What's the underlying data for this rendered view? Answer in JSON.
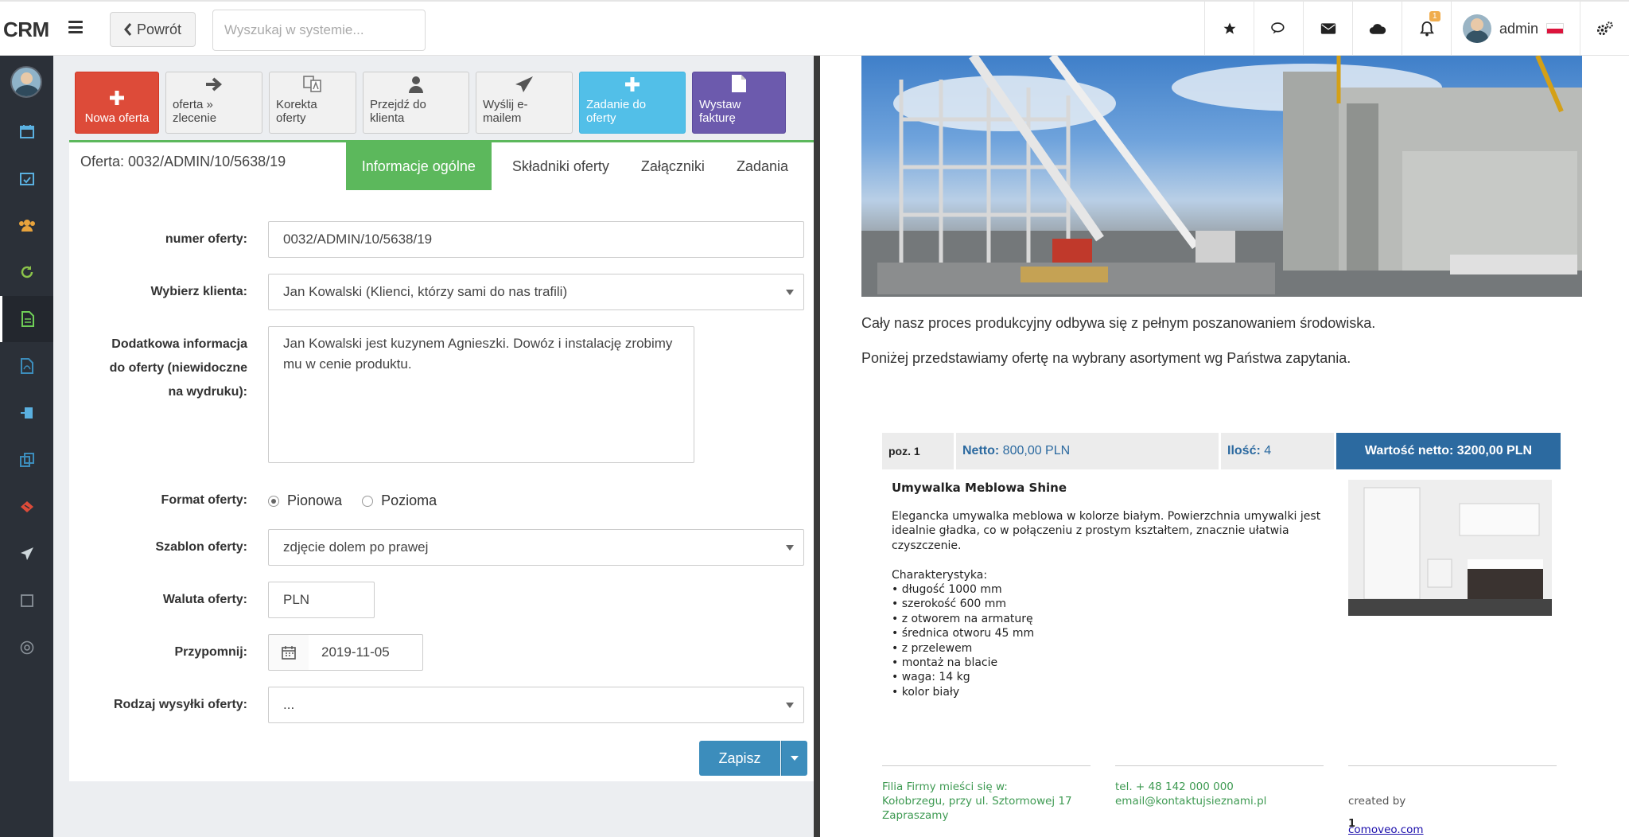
{
  "app": {
    "logo": "CRM"
  },
  "topbar": {
    "back_label": "Powrót",
    "search_placeholder": "Wyszukaj w systemie...",
    "notification_count": "1",
    "user_name": "admin"
  },
  "toolbar": {
    "new_offer": "Nowa oferta",
    "offer_to_order": "oferta » zlecenie",
    "correction": "Korekta oferty",
    "go_to_client": "Przejdź do klienta",
    "send_email": "Wyślij e-mailem",
    "task": "Zadanie do oferty",
    "invoice": "Wystaw fakturę"
  },
  "offer": {
    "title": "Oferta: 0032/ADMIN/10/5638/19",
    "tabs": [
      "Informacje ogólne",
      "Składniki oferty",
      "Załączniki",
      "Zadania"
    ]
  },
  "form": {
    "number_label": "numer oferty:",
    "number_value": "0032/ADMIN/10/5638/19",
    "client_label": "Wybierz klienta:",
    "client_value": "Jan Kowalski (Klienci, którzy sami do nas trafili)",
    "info_label_1": "Dodatkowa informacja",
    "info_label_2": "do oferty (niewidoczne",
    "info_label_3": "na wydruku):",
    "info_value": "Jan Kowalski jest kuzynem Agnieszki. Dowóz i instalację zrobimy mu w cenie produktu.",
    "format_label": "Format oferty:",
    "format_opt1": "Pionowa",
    "format_opt2": "Pozioma",
    "template_label": "Szablon oferty:",
    "template_value": "zdjęcie dolem po prawej",
    "currency_label": "Waluta oferty:",
    "currency_value": "PLN",
    "reminder_label": "Przypomnij:",
    "reminder_value": "2019-11-05",
    "shipping_label": "Rodzaj wysyłki oferty:",
    "shipping_value": "...",
    "save_label": "Zapisz"
  },
  "preview": {
    "para1": "Cały nasz proces produkcyjny odbywa się z pełnym poszanowaniem środowiska.",
    "para2": "Poniżej przedstawiamy ofertę na wybrany asortyment wg Państwa zapytania.",
    "pos_label": "poz. 1",
    "netto_label": "Netto:",
    "netto_value": "800,00 PLN",
    "qty_label": "Ilość:",
    "qty_value": "4",
    "total_label": "Wartość netto: 3200,00 PLN",
    "product_title": "Umywalka Meblowa Shine",
    "product_desc": "Elegancka umywalka meblowa w kolorze białym. Powierzchnia umywalki jest idealnie gładka, co w połączeniu z prostym kształtem, znacznie ułatwia czyszczenie.\n\nCharakterystyka:\n• długość 1000 mm\n• szerokość 600 mm\n• z otworem na armaturę\n• średnica otworu 45 mm\n• z przelewem\n• montaż na blacie\n• waga: 14 kg\n• kolor biały",
    "footer_col1": "Filia Firmy mieści się w:\nKołobrzegu, przy ul. Sztormowej 17\nZapraszamy",
    "footer_col2": "tel. + 48 142 000 000\nemail@kontaktujsieznami.pl",
    "footer_created": "created by",
    "footer_link": "comoveo.com",
    "page_number": "1"
  },
  "colors": {
    "accent_green": "#5cb85c",
    "accent_blue": "#3c8dbc",
    "danger": "#dd4b39",
    "info": "#52bfe8",
    "purple": "#6c5aad",
    "sidebar": "#2b3038"
  }
}
